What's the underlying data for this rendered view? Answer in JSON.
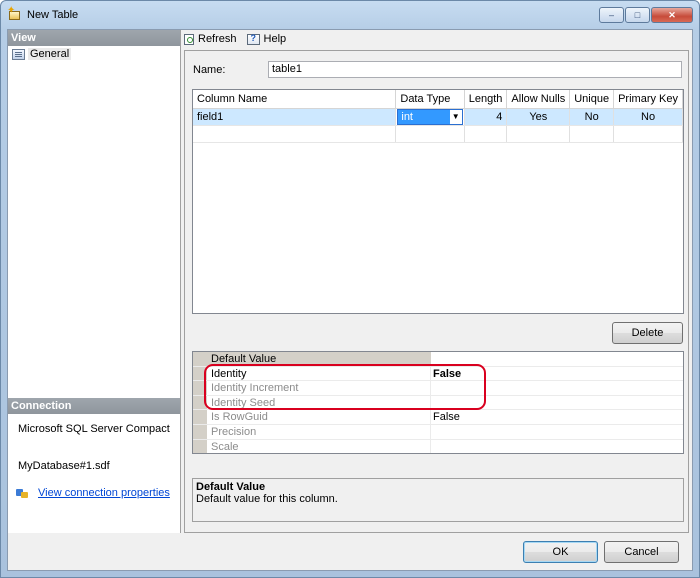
{
  "window": {
    "title": "New Table",
    "minimize": "–",
    "maximize": "□",
    "close": "✕"
  },
  "view_pane": {
    "header": "View",
    "items": [
      {
        "label": "General"
      }
    ]
  },
  "connection": {
    "header": "Connection",
    "server": "Microsoft SQL Server Compact",
    "database": "MyDatabase#1.sdf",
    "link": "View connection properties"
  },
  "toolbar": {
    "refresh": "Refresh",
    "help": "Help"
  },
  "name_field": {
    "label": "Name:",
    "value": "table1"
  },
  "columns_grid": {
    "headers": [
      "Column Name",
      "Data Type",
      "Length",
      "Allow Nulls",
      "Unique",
      "Primary Key"
    ],
    "rows": [
      {
        "name": "field1",
        "data_type": "int",
        "length": "4",
        "allow_nulls": "Yes",
        "unique": "No",
        "primary_key": "No"
      }
    ]
  },
  "delete_button": "Delete",
  "properties": [
    {
      "name": "Default Value",
      "value": ""
    },
    {
      "name": "Identity",
      "value": "False"
    },
    {
      "name": "Identity Increment",
      "value": ""
    },
    {
      "name": "Identity Seed",
      "value": ""
    },
    {
      "name": "Is RowGuid",
      "value": "False"
    },
    {
      "name": "Precision",
      "value": ""
    },
    {
      "name": "Scale",
      "value": ""
    }
  ],
  "description": {
    "title": "Default Value",
    "text": "Default value for this column."
  },
  "footer": {
    "ok": "OK",
    "cancel": "Cancel"
  },
  "colors": {
    "selection": "#cde8ff",
    "highlight": "#d9001f",
    "link": "#0046d5"
  }
}
